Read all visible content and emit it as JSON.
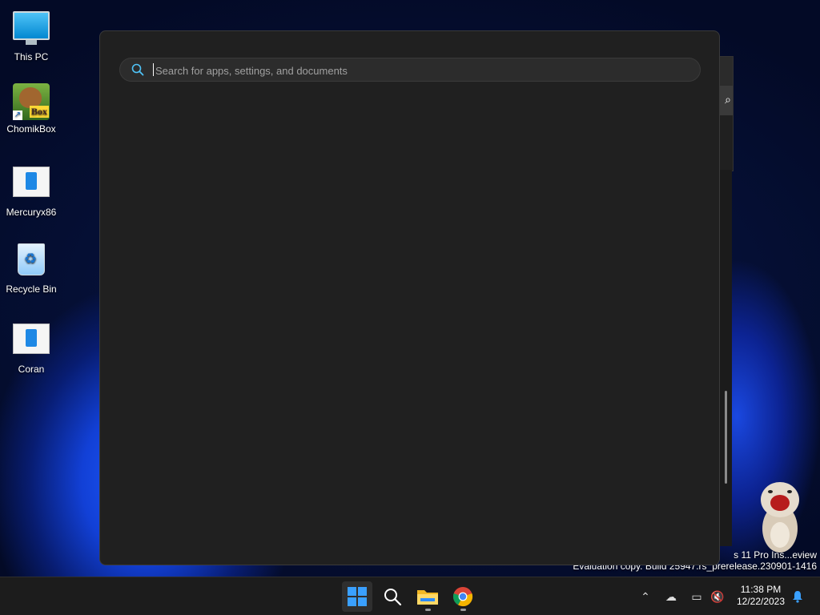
{
  "desktop": {
    "icons": [
      {
        "label": "This PC",
        "icon": "this-pc-icon"
      },
      {
        "label": "ChomikBox",
        "icon": "chomikbox-icon",
        "badge": "Box"
      },
      {
        "label": "Mercuryx86",
        "icon": "document-icon"
      },
      {
        "label": "Recycle Bin",
        "icon": "recycle-bin-icon"
      },
      {
        "label": "Coran",
        "icon": "document-icon"
      }
    ]
  },
  "search": {
    "placeholder": "Search for apps, settings, and documents",
    "value": ""
  },
  "watermark": {
    "line1": "s 11 Pro Ins...eview",
    "line2": "Evaluation copy. Build 25947.rs_prerelease.230901-1416"
  },
  "taskbar": {
    "apps": [
      {
        "name": "Start",
        "icon": "windows-logo-icon",
        "active": true
      },
      {
        "name": "Search",
        "icon": "search-icon"
      },
      {
        "name": "File Explorer",
        "icon": "folder-icon",
        "running": true
      },
      {
        "name": "Google Chrome",
        "icon": "chrome-icon",
        "running": true
      }
    ],
    "tray": {
      "icons": [
        "chevron-up-icon",
        "onedrive-icon",
        "network-icon",
        "volume-muted-icon"
      ],
      "time": "11:38 PM",
      "date": "12/22/2023",
      "notification_icon": "bell-icon"
    }
  },
  "colors": {
    "accent": "#0078d4",
    "flyout_bg": "#202020",
    "taskbar_bg": "#1c1c1c"
  }
}
